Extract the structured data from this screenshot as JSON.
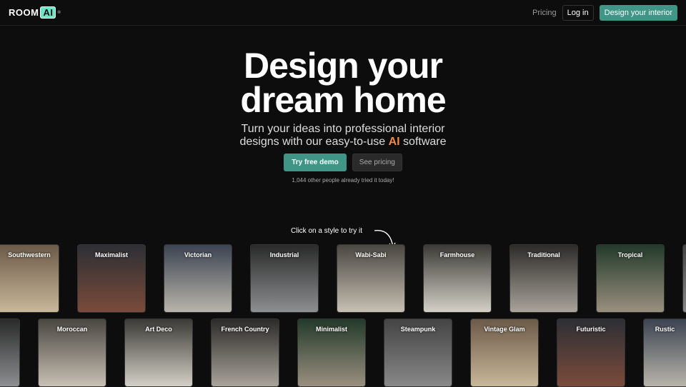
{
  "nav": {
    "logo_text": "ROOM",
    "logo_badge": "AI",
    "pricing": "Pricing",
    "login": "Log in",
    "cta": "Design your interior"
  },
  "hero": {
    "title_line1": "Design your",
    "title_line2": "dream home",
    "sub_line1": "Turn your ideas into professional interior",
    "sub_line2_pre": "designs with our easy-to-use ",
    "sub_ai": "AI",
    "sub_line2_post": " software",
    "try_demo": "Try free demo",
    "see_pricing": "See pricing",
    "social_proof": "1,044 other people already tried it today!"
  },
  "styles": {
    "hint": "Click on a style to try it",
    "row1": [
      "Southwestern",
      "Maximalist",
      "Victorian",
      "Industrial",
      "Wabi-Sabi",
      "Farmhouse",
      "Traditional",
      "Tropical",
      ""
    ],
    "row2": [
      "",
      "Moroccan",
      "Art Deco",
      "French Country",
      "Minimalist",
      "Steampunk",
      "Vintage Glam",
      "Futuristic",
      "Rustic"
    ]
  },
  "colors": {
    "accent": "#3f9687",
    "ai_highlight": "#f0894a",
    "background": "#0d0d0d"
  }
}
